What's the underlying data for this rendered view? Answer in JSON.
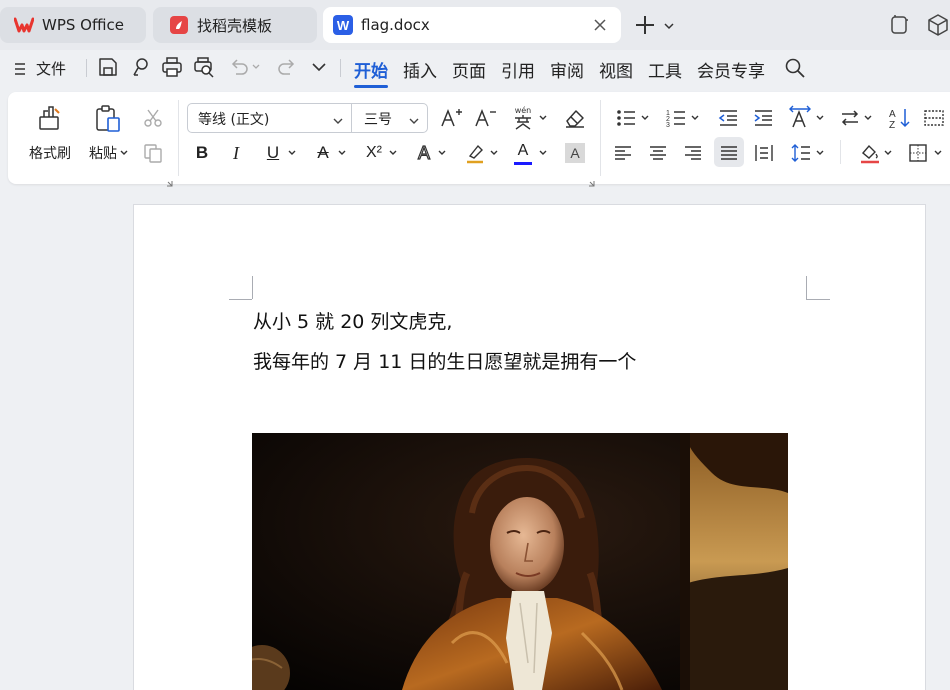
{
  "tabs": [
    {
      "label": "WPS Office"
    },
    {
      "label": "找稻壳模板"
    },
    {
      "label": "flag.docx"
    }
  ],
  "menu": {
    "file_label": "文件",
    "tabs": [
      "开始",
      "插入",
      "页面",
      "引用",
      "审阅",
      "视图",
      "工具",
      "会员专享"
    ],
    "active_tab": "开始"
  },
  "ribbon": {
    "format_painter_label": "格式刷",
    "paste_label": "粘贴",
    "font_name": "等线 (正文)",
    "font_size": "三号",
    "pinyin_glyph": "wén",
    "bold": "B",
    "italic": "I",
    "underline": "U",
    "strike": "A",
    "superscript": "X²",
    "text_effect": "A",
    "font_color_glyph": "A",
    "char_shade": "A",
    "font_color_hex": "#1a1aff",
    "accent_color": "#1f5fd6"
  },
  "document": {
    "line1": "从小 5 就 20 列文虎克,",
    "line2": "我每年的 7 月 11 日的生日愿望就是拥有一个"
  },
  "colors": {
    "wps_red": "#e8352f",
    "word_blue": "#2b5fe6",
    "template_red": "#e64545"
  }
}
